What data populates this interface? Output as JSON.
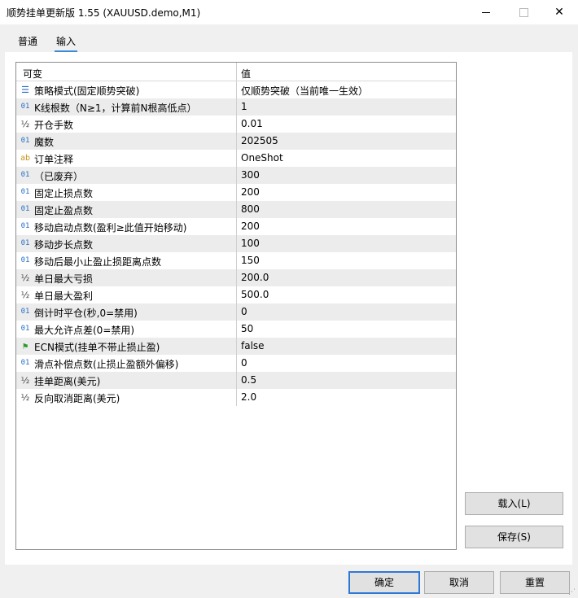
{
  "window": {
    "title": "顺势挂单更新版 1.55 (XAUUSD.demo,M1)",
    "min_icon": "minimize-icon",
    "max_icon": "maximize-icon",
    "close_icon": "close-icon",
    "close_glyph": "✕"
  },
  "tabs": [
    {
      "label": "普通",
      "active": false
    },
    {
      "label": "输入",
      "active": true
    }
  ],
  "grid": {
    "header_variable": "可变",
    "header_value": "值",
    "rows": [
      {
        "icon": "list",
        "glyph": "☰",
        "name": "策略模式(固定顺势突破)",
        "value": "仅顺势突破（当前唯一生效）"
      },
      {
        "icon": "int",
        "glyph": "01",
        "name": "K线根数（N≥1，计算前N根高低点）",
        "value": "1"
      },
      {
        "icon": "half",
        "glyph": "½",
        "name": "开仓手数",
        "value": "0.01"
      },
      {
        "icon": "int",
        "glyph": "01",
        "name": "魔数",
        "value": "202505"
      },
      {
        "icon": "ab",
        "glyph": "ab",
        "name": "订单注释",
        "value": "OneShot"
      },
      {
        "icon": "int",
        "glyph": "01",
        "name": "（已废弃）",
        "value": "300"
      },
      {
        "icon": "int",
        "glyph": "01",
        "name": "固定止损点数",
        "value": "200"
      },
      {
        "icon": "int",
        "glyph": "01",
        "name": "固定止盈点数",
        "value": "800"
      },
      {
        "icon": "int",
        "glyph": "01",
        "name": "移动启动点数(盈利≥此值开始移动)",
        "value": "200"
      },
      {
        "icon": "int",
        "glyph": "01",
        "name": "移动步长点数",
        "value": "100"
      },
      {
        "icon": "int",
        "glyph": "01",
        "name": "移动后最小止盈止损距离点数",
        "value": "150"
      },
      {
        "icon": "half",
        "glyph": "½",
        "name": "单日最大亏损",
        "value": "200.0"
      },
      {
        "icon": "half",
        "glyph": "½",
        "name": "单日最大盈利",
        "value": "500.0"
      },
      {
        "icon": "int",
        "glyph": "01",
        "name": "倒计时平仓(秒,0=禁用)",
        "value": "0"
      },
      {
        "icon": "int",
        "glyph": "01",
        "name": "最大允许点差(0=禁用)",
        "value": "50"
      },
      {
        "icon": "flag",
        "glyph": "⚑",
        "name": "ECN模式(挂单不带止损止盈)",
        "value": "false"
      },
      {
        "icon": "int",
        "glyph": "01",
        "name": "滑点补偿点数(止损止盈额外偏移)",
        "value": "0"
      },
      {
        "icon": "half",
        "glyph": "½",
        "name": "挂单距离(美元)",
        "value": "0.5"
      },
      {
        "icon": "half",
        "glyph": "½",
        "name": "反向取消距离(美元)",
        "value": "2.0"
      }
    ]
  },
  "buttons": {
    "load": "载入(L)",
    "save": "保存(S)",
    "ok": "确定",
    "cancel": "取消",
    "reset": "重置"
  },
  "colors": {
    "accent": "#3c8ad8",
    "ok_border": "#2f79d6",
    "alt_row": "#ececec"
  }
}
